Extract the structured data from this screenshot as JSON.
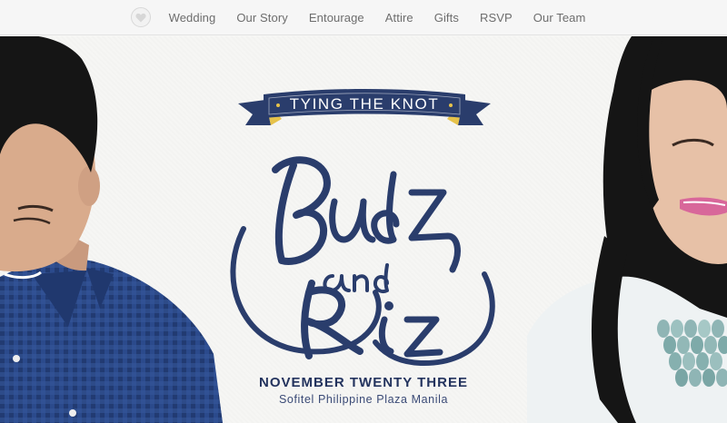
{
  "nav": {
    "home_icon": "heart-icon",
    "items": [
      {
        "label": "Wedding"
      },
      {
        "label": "Our Story"
      },
      {
        "label": "Entourage"
      },
      {
        "label": "Attire"
      },
      {
        "label": "Gifts"
      },
      {
        "label": "RSVP"
      },
      {
        "label": "Our Team"
      }
    ]
  },
  "hero": {
    "banner_text": "TYING THE KNOT",
    "names_script": "Budz and Riz",
    "date": "NOVEMBER TWENTY THREE",
    "venue": "Sofitel Philippine Plaza Manila"
  },
  "colors": {
    "navy": "#2a3d6c",
    "gold": "#e6c24a",
    "background": "#f6f6f4",
    "nav_text": "#6d6d6d"
  }
}
